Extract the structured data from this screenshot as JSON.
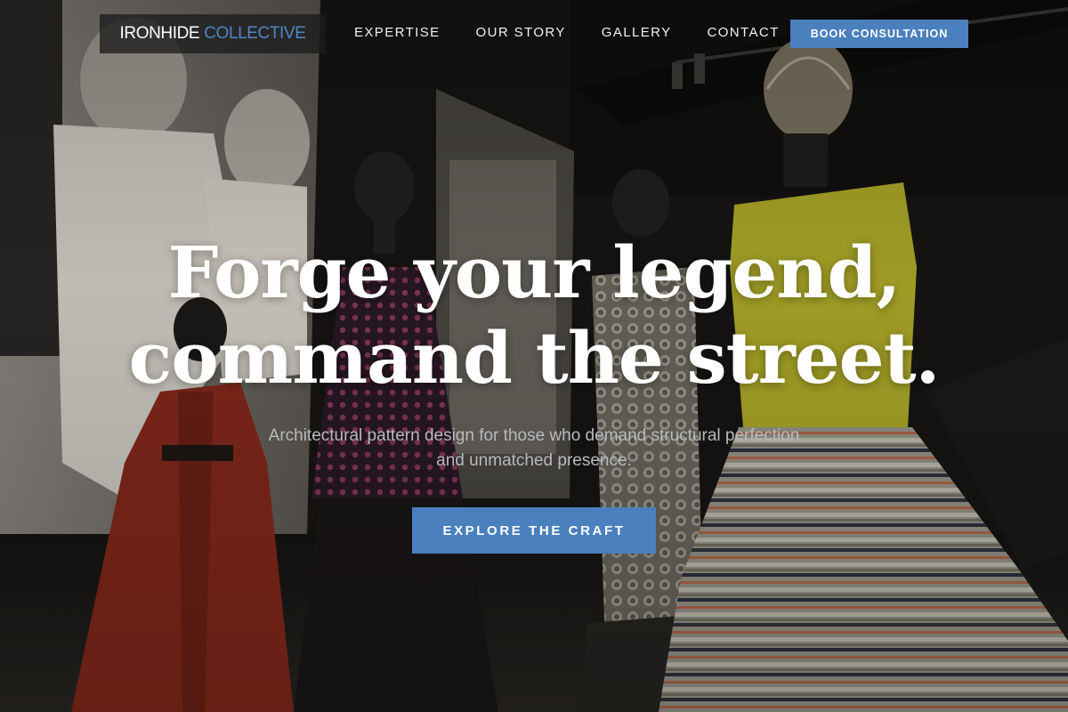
{
  "brand": {
    "name_primary": "IRONHIDE",
    "name_accent": "COLLECTIVE",
    "accent_color": "#4f86c6"
  },
  "nav": {
    "items": [
      {
        "label": "EXPERTISE"
      },
      {
        "label": "OUR STORY"
      },
      {
        "label": "GALLERY"
      },
      {
        "label": "CONTACT"
      }
    ],
    "cta_label": "BOOK CONSULTATION"
  },
  "hero": {
    "headline_line1": "Forge your legend,",
    "headline_line2": "command the street.",
    "subtitle": "Architectural pattern design for those who demand structural perfection and unmatched presence.",
    "cta_label": "EXPLORE THE CRAFT",
    "background_image": "fashion-exhibition-mannequins-photo"
  },
  "colors": {
    "button_blue": "#4a80bd",
    "text_white": "#ffffff",
    "subtitle_gray": "#b9b9bf"
  }
}
